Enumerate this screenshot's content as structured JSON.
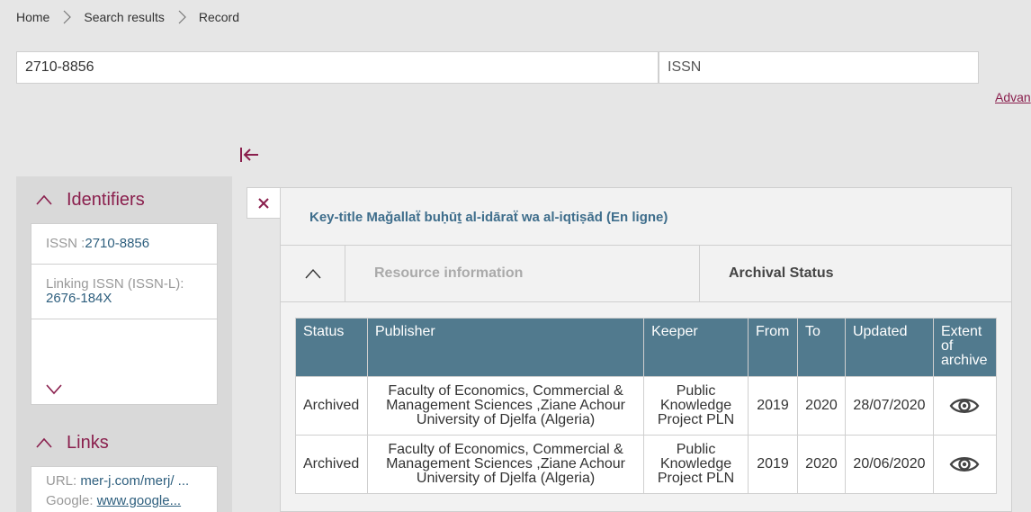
{
  "breadcrumb": {
    "home": "Home",
    "search_results": "Search results",
    "record": "Record"
  },
  "search": {
    "value": "2710-8856",
    "type": "ISSN",
    "advanced": "Advan"
  },
  "sidebar": {
    "identifiers_title": "Identifiers",
    "issn_label": "ISSN :",
    "issn_value": "2710-8856",
    "linking_label": "Linking ISSN (ISSN-L):",
    "linking_value": "2676-184X",
    "links_title": "Links",
    "url_label": "URL: ",
    "url_value": "mer-j.com/merj/ ...",
    "google_label": "Google: ",
    "google_value": "www.google..."
  },
  "record": {
    "key_title": "Key-title Maǧallaẗ buḥūṯ al-idāraẗ wa al-iqtiṣād (En ligne)",
    "tab_resource": "Resource information",
    "tab_archival": "Archival Status"
  },
  "table": {
    "headers": [
      "Status",
      "Publisher",
      "Keeper",
      "From",
      "To",
      "Updated",
      "Extent of archive"
    ],
    "rows": [
      {
        "status": "Archived",
        "publisher": "Faculty of Economics, Commercial & Management Sciences ,Ziane Achour University of Djelfa (Algeria)",
        "keeper": "Public Knowledge Project PLN",
        "from": "2019",
        "to": "2020",
        "updated": "28/07/2020",
        "extent_icon": "eye-icon"
      },
      {
        "status": "Archived",
        "publisher": "Faculty of Economics, Commercial & Management Sciences ,Ziane Achour University of Djelfa (Algeria)",
        "keeper": "Public Knowledge Project PLN",
        "from": "2019",
        "to": "2020",
        "updated": "20/06/2020",
        "extent_icon": "eye-icon"
      }
    ]
  },
  "colors": {
    "accent": "#8a1f4d",
    "table_header": "#517a8e",
    "link_blue": "#2e5f7e",
    "background": "#e6e6e6"
  }
}
